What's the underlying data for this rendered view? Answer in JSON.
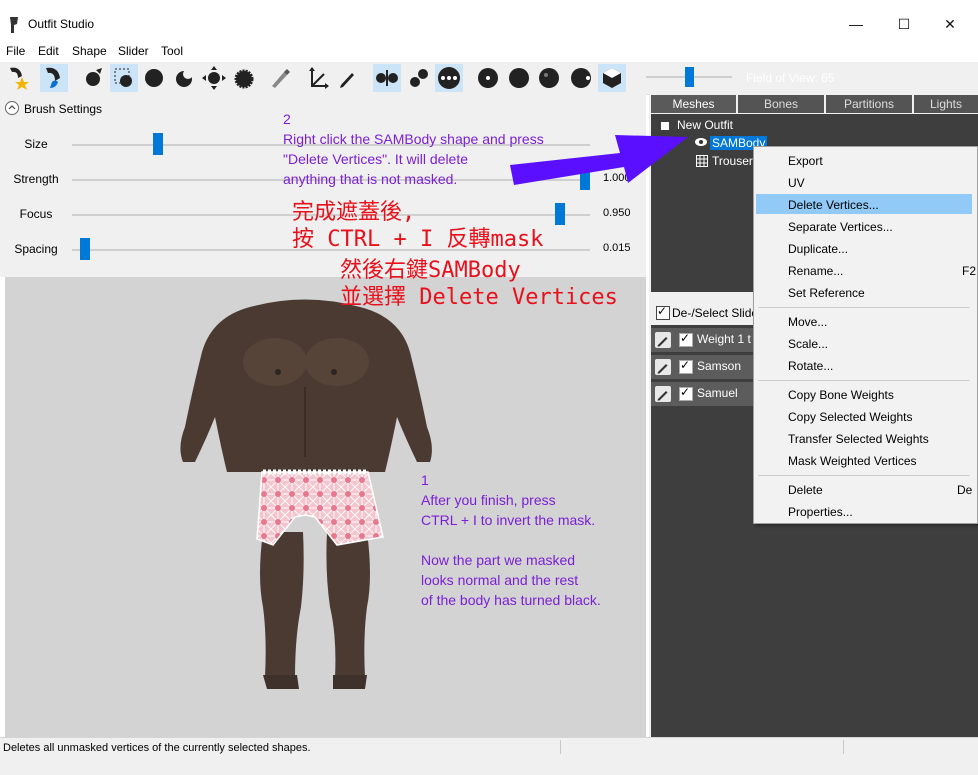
{
  "window": {
    "title": "Outfit Studio",
    "minimize": "—",
    "maximize": "☐",
    "close": "✕"
  },
  "menu": {
    "items": [
      "File",
      "Edit",
      "Shape",
      "Slider",
      "Tool"
    ]
  },
  "toolbar": {
    "field_of_view": "Field of View: 65",
    "fov_level": 0.5
  },
  "brush": {
    "title": "Brush Settings",
    "sliders": [
      {
        "label": "Size",
        "value": "",
        "level": 0.16
      },
      {
        "label": "Strength",
        "value": "1.000",
        "level": 1.0
      },
      {
        "label": "Focus",
        "value": "0.950",
        "level": 0.95
      },
      {
        "label": "Spacing",
        "value": "0.015",
        "level": 0.015
      }
    ]
  },
  "right_panel": {
    "tabs": [
      "Meshes",
      "Bones",
      "Partitions",
      "Lights"
    ],
    "active_tab": "Meshes",
    "tree": {
      "root": "New Outfit",
      "items": [
        "SAMBody",
        "Trouser"
      ]
    },
    "slider_header": "De-/Select Slide",
    "sliders": [
      "Weight 1 t",
      "Samson",
      "Samuel"
    ]
  },
  "context_menu": {
    "items": [
      {
        "label": "Export"
      },
      {
        "label": "UV"
      },
      {
        "label": "Delete Vertices...",
        "highlighted": true
      },
      {
        "label": "Separate Vertices..."
      },
      {
        "label": "Duplicate..."
      },
      {
        "label": "Rename...",
        "shortcut": "F2"
      },
      {
        "label": "Set Reference"
      },
      {
        "label": "Move..."
      },
      {
        "label": "Scale..."
      },
      {
        "label": "Rotate..."
      },
      {
        "label": "Copy Bone Weights"
      },
      {
        "label": "Copy Selected Weights"
      },
      {
        "label": "Transfer Selected Weights"
      },
      {
        "label": "Mask Weighted Vertices"
      },
      {
        "label": "Delete",
        "shortcut": "De"
      },
      {
        "label": "Properties..."
      }
    ]
  },
  "status": {
    "text": "Deletes all unmasked vertices of the currently selected shapes."
  },
  "annotations": {
    "step2": [
      "2",
      "Right click the SAMBody shape and press",
      "\"Delete Vertices\". It will delete",
      "anything that is not masked."
    ],
    "zh": [
      "完成遮蓋後,",
      "按 CTRL + I 反轉mask",
      "然後右鍵SAMBody",
      "並選擇 Delete Vertices"
    ],
    "step1": [
      "1",
      "After you finish, press",
      "CTRL + I to invert the mask.",
      "",
      "Now the part we masked",
      "looks normal and the rest",
      "of the body has turned black."
    ]
  },
  "colors": {
    "accent": "#0078d7",
    "annotation": "#7a1fd6",
    "annotation_zh": "#e8101b",
    "arrow": "#5a10ff",
    "highlight": "#91c9f7"
  }
}
